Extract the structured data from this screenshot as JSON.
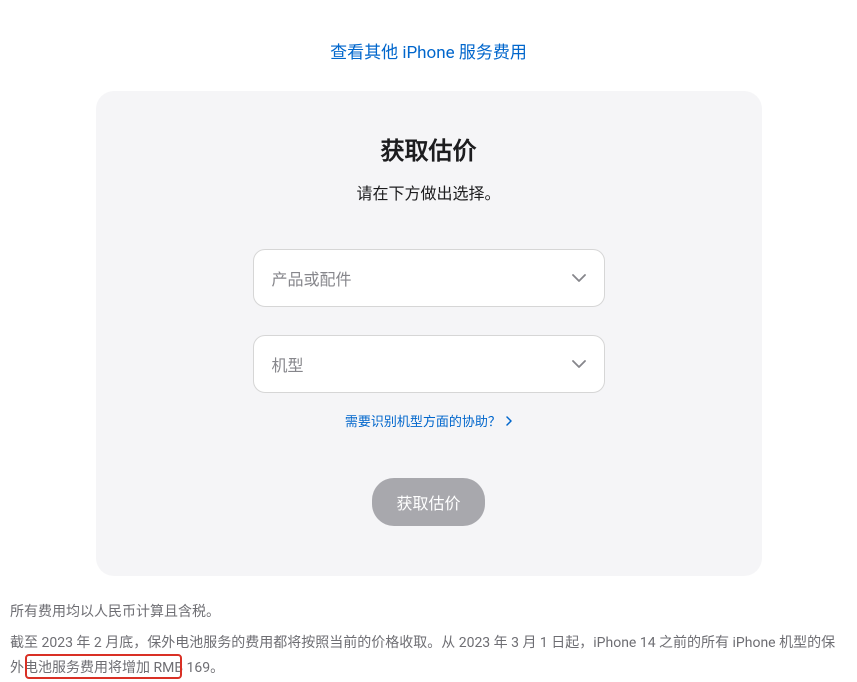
{
  "topLink": {
    "text": "查看其他 iPhone 服务费用"
  },
  "card": {
    "title": "获取估价",
    "subtitle": "请在下方做出选择。",
    "select1": {
      "placeholder": "产品或配件"
    },
    "select2": {
      "placeholder": "机型"
    },
    "helpLink": {
      "text": "需要识别机型方面的协助？"
    },
    "submitButton": {
      "label": "获取估价"
    }
  },
  "footer": {
    "line1": "所有费用均以人民币计算且含税。",
    "line2": "截至 2023 年 2 月底，保外电池服务的费用都将按照当前的价格收取。从 2023 年 3 月 1 日起，iPhone 14 之前的所有 iPhone 机型的保外电池服务费用将增加 RMB 169。"
  }
}
